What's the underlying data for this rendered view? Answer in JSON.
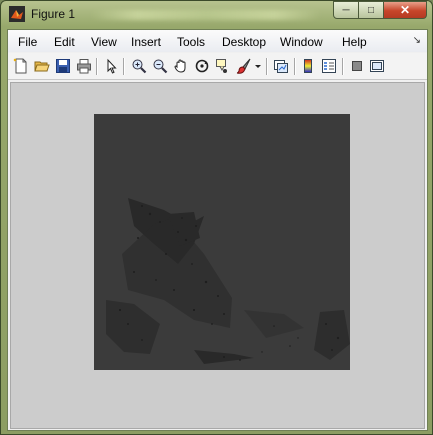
{
  "window": {
    "title": "Figure 1",
    "controls": {
      "minimize": "─",
      "maximize": "□",
      "close": "✕"
    }
  },
  "menubar": {
    "items": [
      "File",
      "Edit",
      "View",
      "Insert",
      "Tools",
      "Desktop",
      "Window",
      "Help"
    ],
    "dock_glyph": "↘"
  },
  "toolbar": {
    "icons": [
      "new-figure-icon",
      "open-file-icon",
      "save-icon",
      "print-icon",
      "edit-plot-icon",
      "zoom-in-icon",
      "zoom-out-icon",
      "pan-icon",
      "rotate-3d-icon",
      "data-cursor-icon",
      "brush-icon",
      "brush-dropdown-icon",
      "link-plot-icon",
      "insert-colorbar-icon",
      "insert-legend-icon",
      "hide-plot-tools-icon",
      "show-plot-tools-icon"
    ]
  },
  "colors": {
    "axes_background": "#3b3b3b",
    "figure_background": "#cccccc",
    "image_speckle": "#1e1e1e"
  }
}
